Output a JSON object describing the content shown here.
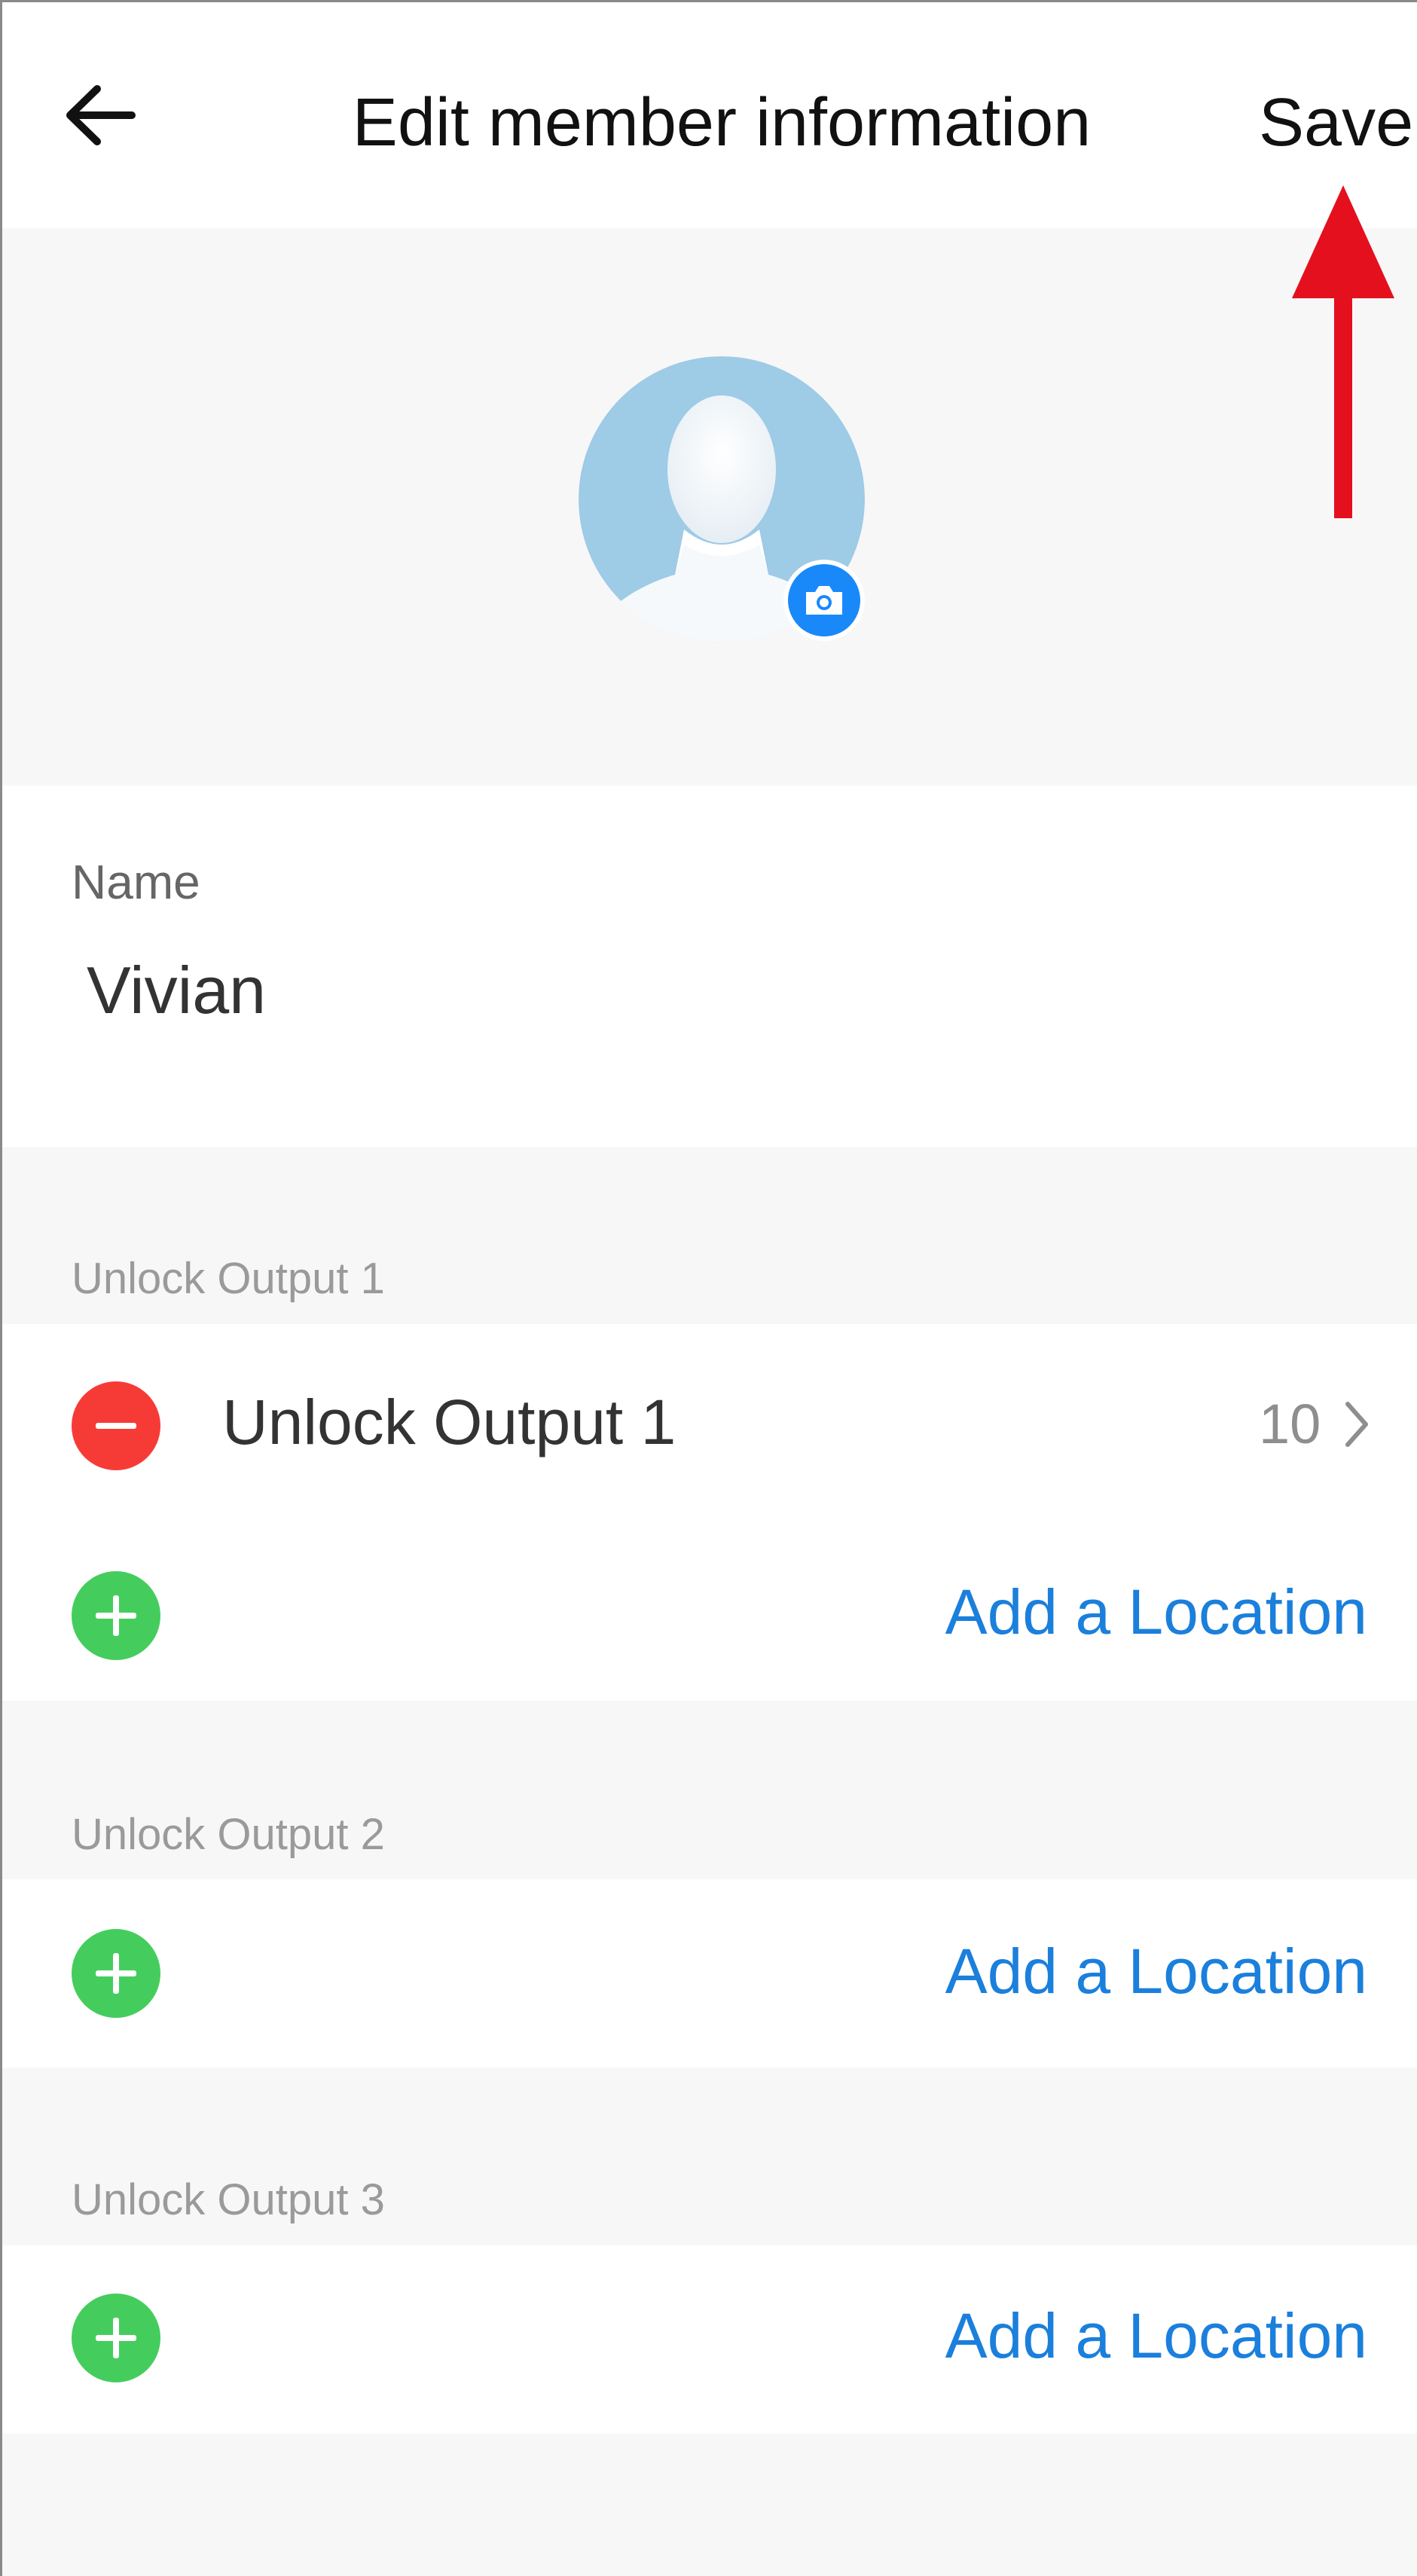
{
  "header": {
    "back_icon": "back-arrow-icon",
    "title": "Edit member information",
    "save_label": "Save"
  },
  "avatar": {
    "icon": "default-user-avatar",
    "camera_icon": "camera-icon",
    "colors": {
      "avatar_bg": "#9ecbe6",
      "camera_bg": "#1989fa"
    }
  },
  "name_field": {
    "label": "Name",
    "value": "Vivian"
  },
  "sections": [
    {
      "label": "Unlock Output 1",
      "items": [
        {
          "name": "Unlock Output 1",
          "count": "10",
          "remove_icon": "minus-circle-icon",
          "chevron_icon": "chevron-right-icon"
        }
      ],
      "add_label": "Add a Location",
      "add_icon": "plus-circle-icon"
    },
    {
      "label": "Unlock Output 2",
      "items": [],
      "add_label": "Add a Location",
      "add_icon": "plus-circle-icon"
    },
    {
      "label": "Unlock Output 3",
      "items": [],
      "add_label": "Add a Location",
      "add_icon": "plus-circle-icon"
    }
  ],
  "annotation": {
    "icon": "red-arrow-up-icon",
    "color": "#e4101e"
  },
  "colors": {
    "accent": "#1b7fdc",
    "remove": "#f63b37",
    "add": "#44cd5d",
    "page_bg": "#f7f7f7"
  }
}
